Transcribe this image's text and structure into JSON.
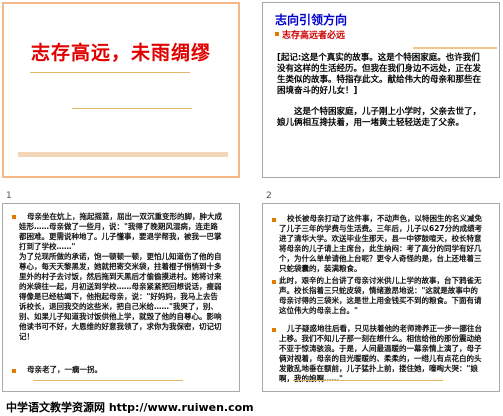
{
  "slides": [
    {
      "number": "1",
      "title": "志存高远，未雨绸缪"
    },
    {
      "number": "2",
      "heading": "志向引领方向",
      "subtitle": "志存高远者必远",
      "para1": "[起记:这是个真实的故事。这是个特困家庭。也许我们没有这样的生活经历。但我在我们身边不远处，正在发生类似的故事。特指存此文。献给伟大的母亲和那些在困境奋斗的好儿女！]",
      "para2": "这是个特困家庭，儿子刚上小学时，父亲去世了，娘儿俩相互搀扶着，用一堵黄土轻轻送走了父亲。"
    },
    {
      "number": "3",
      "text1": "母亲坐在炕上，拖起摇篮，屈出一双沉重变形的脚，肿大成娃形……母亲做了一些月，说：\"我得了晚期风湿病，连走路都困难。更需说种地了。儿子懂事，要退学帮我，被我一巴掌打到了学校……\"\n为了兑现所做的承诺，饱一顿顿一顿，更怕儿知道伤了他的自尊心，每天天黎黑发，她就把寄交米袋，拄着棍子悄悄到十多里外的村子去讨饭，然后拖到天黑后才偷偷摸进村。她将讨来的米袋往一起，月初送到学校……母亲紧紧把回想说话，瘦弱得像是已经枯竭下，他抱起母亲，说：\"好妈妈，我马上去告诉校长，退回我交的这些米，把自己米给……\"我哭了，别、别、如果儿子知道我讨饭供他上学，就毁了他的自尊心。影响他读书可不好，大恩维的好意我领了，求你为我保密，切记切记！",
      "text2": "母亲老了，一瘸一拐。"
    },
    {
      "number": "4",
      "text1": "校长被母亲打动了这件事，不动声色，以特困生的名义减免了儿子三年的学费与生活费。三年后，儿子以627分的成绩考进了清华大学。欢送毕业生那天，县一中锣鼓喧天，校长特意将母亲的儿子请上主席台，此生纳闷：考了高分的同学有好几个，为什么单单请他上台呢？更令人奇怪的是，台上还堆着三只蛇袋囊的，装满粮食。",
      "text2": "此时，艰辛的上台讲了母亲讨米供儿上学的故事，台下鸦雀无声。校长指着三只蛇皮袋，情绪激昂地说：\"这就是故事中的母亲讨得的三袋米，这是世上用金钱买不到的粮食。下面有请这位伟大的母亲上台。\"",
      "text3": "儿子疑惑地往后看，只见扶着他的老师搀养正一步一挪往台上移。我们不知儿子那一刻在想什么。相信给他的那份震动绝不亚于惊涛骇浪。于是，人间最温暖的一幕亲情上演了，母子俩对视着，母亲的目光暖暖的、柔柔的，一绺儿有点花白的头发散乱地垂在额前，儿子猛扑上前，搂住她，嚎啕大哭：\"娘啊，我的娘啊……\""
    }
  ],
  "banner": "中学语文教学资源网 http://www.ruiwen.com"
}
